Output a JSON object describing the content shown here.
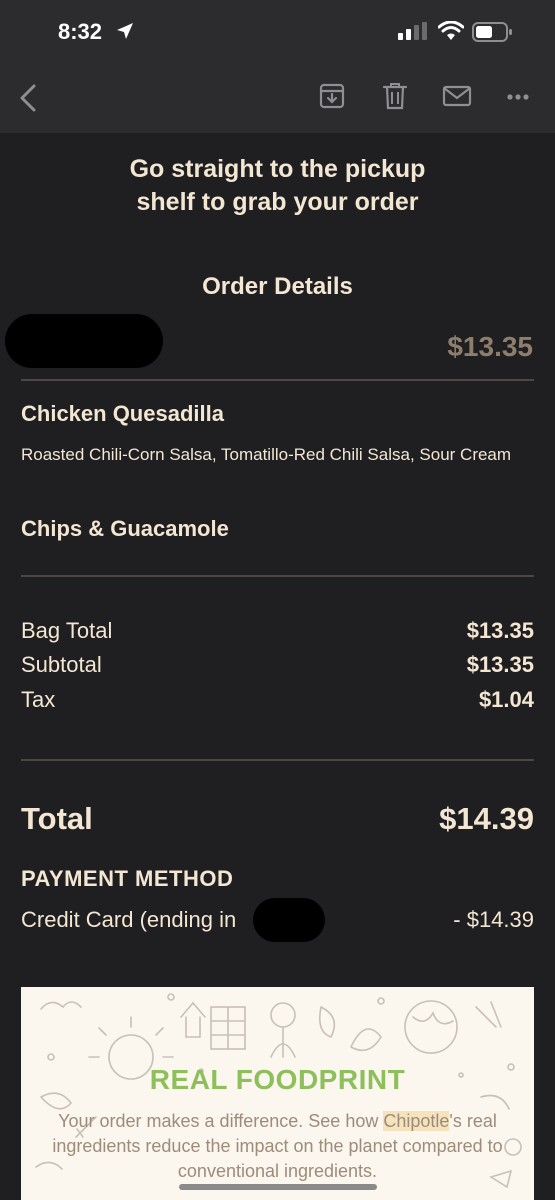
{
  "status_bar": {
    "time": "8:32"
  },
  "toolbar": {
    "back": "back-chevron-icon",
    "archive": "archive-icon",
    "delete": "trash-icon",
    "mail": "mail-icon",
    "more": "more-icon"
  },
  "email": {
    "headline_line1": "Go straight to the pickup",
    "headline_line2": "shelf to grab your order",
    "section_title": "Order Details",
    "order_total_top": "$13.35",
    "items": [
      {
        "name": "Chicken Quesadilla",
        "modifiers": "Roasted Chili-Corn Salsa, Tomatillo-Red Chili Salsa, Sour Cream"
      },
      {
        "name": "Chips & Guacamole"
      }
    ],
    "summary": [
      {
        "label": "Bag Total",
        "value": "$13.35"
      },
      {
        "label": "Subtotal",
        "value": "$13.35"
      },
      {
        "label": "Tax",
        "value": "$1.04"
      }
    ],
    "total": {
      "label": "Total",
      "value": "$14.39"
    },
    "payment": {
      "title": "PAYMENT METHOD",
      "card": "Credit Card (ending in",
      "amount": "- $14.39"
    },
    "banner": {
      "title": "REAL FOODPRINT",
      "text_before": "Your order makes a difference. See how ",
      "text_highlight": "Chipotle",
      "text_after": "'s real ingredients reduce the impact on the planet compared to conventional ingredients.",
      "title_color": "#8dbf5a"
    }
  },
  "colors": {
    "background": "#1f1f21",
    "bar": "#2c2c2e",
    "text": "#f3e6d2",
    "muted_price": "#8f7e6c"
  }
}
